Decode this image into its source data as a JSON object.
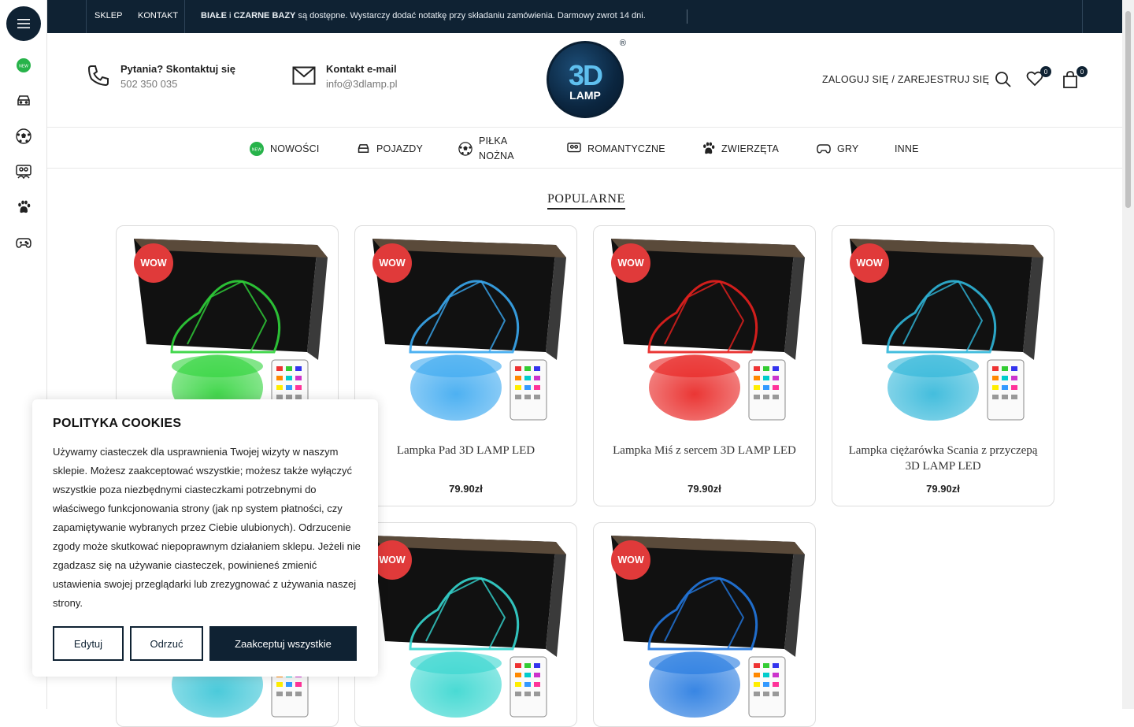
{
  "topbar": {
    "links": [
      "SKLEP",
      "KONTAKT"
    ],
    "promo_bold1": "BIAŁE",
    "promo_mid": " i ",
    "promo_bold2": "CZARNE BAZY",
    "promo_rest": " są dostępne. Wystarczy dodać notatkę przy składaniu zamówienia. Darmowy zwrot 14 dni."
  },
  "header": {
    "phone_title": "Pytania? Skontaktuj się",
    "phone_value": "502 350 035",
    "email_title": "Kontakt e-mail",
    "email_value": "info@3dlamp.pl",
    "logo_big": "3D",
    "logo_small": "LAMP",
    "logo_reg": "®",
    "account_label": "ZALOGUJ SIĘ / ZAREJESTRUJ SIĘ",
    "wishlist_count": "0",
    "cart_count": "0"
  },
  "nav": {
    "items": [
      "NOWOŚCI",
      "POJAZDY",
      "PIŁKA",
      "NOŻNA",
      "ROMANTYCZNE",
      "ZWIERZĘTA",
      "GRY",
      "INNE"
    ]
  },
  "section": {
    "title": "POPULARNE"
  },
  "products": [
    {
      "badge": "WOW",
      "title": "",
      "price": "",
      "accent": "#2fd33a"
    },
    {
      "badge": "WOW",
      "title": "Lampka Pad 3D LAMP LED",
      "price": "79.90zł",
      "accent": "#3aa8f0"
    },
    {
      "badge": "WOW",
      "title": "Lampka Miś z sercem 3D LAMP LED",
      "price": "79.90zł",
      "accent": "#e8201e"
    },
    {
      "badge": "WOW",
      "title": "Lampka ciężarówka Scania z przyczepą 3D LAMP LED",
      "price": "79.90zł",
      "accent": "#2fb6d9"
    },
    {
      "badge": "WOW",
      "title": "",
      "price": "",
      "accent": "#37c4d6"
    },
    {
      "badge": "WOW",
      "title": "",
      "price": "",
      "accent": "#35d6cf"
    },
    {
      "badge": "WOW",
      "title": "",
      "price": "",
      "accent": "#2278e0"
    }
  ],
  "cookie": {
    "title": "POLITYKA COOKIES",
    "text": "Używamy ciasteczek dla usprawnienia Twojej wizyty w naszym sklepie. Możesz zaakceptować wszystkie; możesz także wyłączyć wszystkie poza niezbędnymi ciasteczkami potrzebnymi do właściwego funkcjonowania strony (jak np system płatności, czy zapamiętywanie wybranych przez Ciebie ulubionych). Odrzucenie zgody może skutkować niepoprawnym działaniem sklepu. Jeżeli nie zgadzasz się na używanie ciasteczek, powinieneś zmienić ustawienia swojej przeglądarki lub zrezygnować z używania naszej strony.",
    "edit": "Edytuj",
    "reject": "Odrzuć",
    "accept": "Zaakceptuj wszystkie"
  },
  "colors": {
    "navy": "#0f2233",
    "wow": "#e03a3a"
  }
}
